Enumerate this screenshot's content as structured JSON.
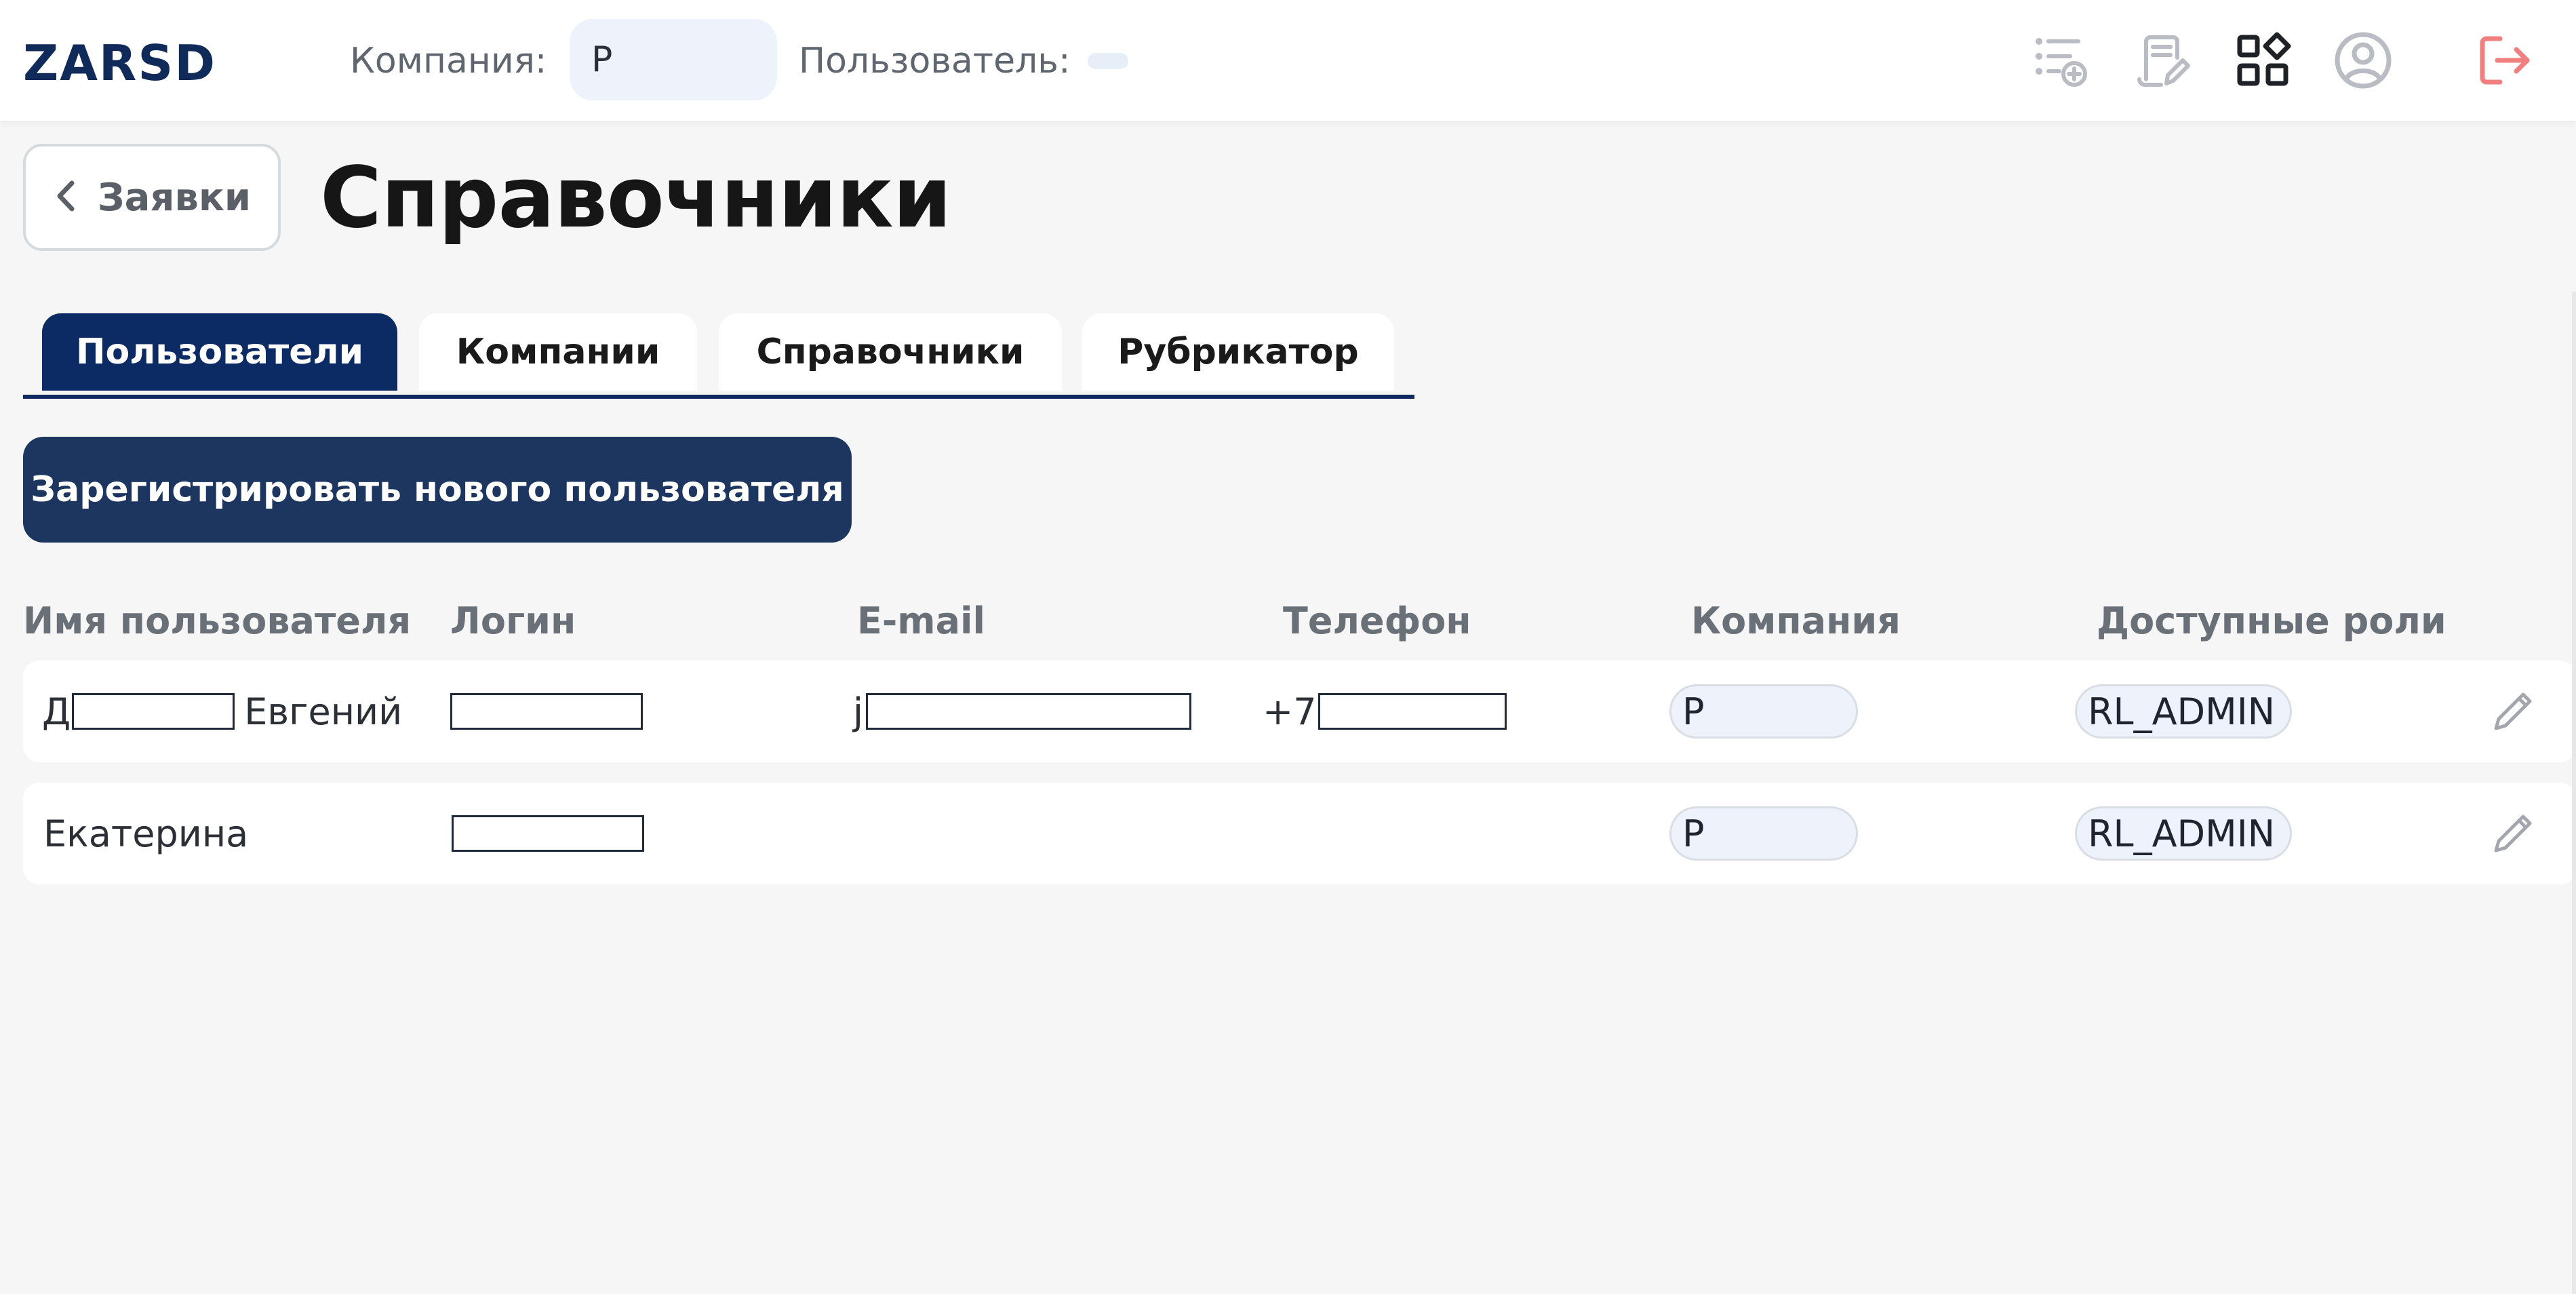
{
  "header": {
    "logo": "ZARSD",
    "company_label": "Компания:",
    "company_value": "Р",
    "user_label": "Пользователь:",
    "user_value": "",
    "icons": [
      "task-add-icon",
      "document-edit-icon",
      "apps-grid-icon",
      "user-account-icon",
      "logout-icon"
    ],
    "logout_color": "#f08080"
  },
  "back_button": {
    "label": "Заявки"
  },
  "page": {
    "title": "Справочники"
  },
  "tabs": [
    {
      "label": "Пользователи",
      "active": true
    },
    {
      "label": "Компании",
      "active": false
    },
    {
      "label": "Справочники",
      "active": false
    },
    {
      "label": "Рубрикатор",
      "active": false
    }
  ],
  "register_button": {
    "label": "Зарегистрировать нового пользователя"
  },
  "table": {
    "columns": [
      "Имя пользователя",
      "Логин",
      "E-mail",
      "Телефон",
      "Компания",
      "Доступные роли"
    ],
    "rows": [
      {
        "name_prefix": "Д",
        "name_suffix": "Евгений",
        "email_prefix": "j",
        "phone_prefix": "+7",
        "company": "Р",
        "role": "RL_ADMIN"
      },
      {
        "name_suffix": "Екатерина",
        "company": "Р",
        "role": "RL_ADMIN"
      }
    ]
  },
  "colors": {
    "primary": "#0c2a63",
    "button": "#1d3660",
    "pill_bg": "#edf2fb",
    "page_bg": "#f6f6f7"
  }
}
